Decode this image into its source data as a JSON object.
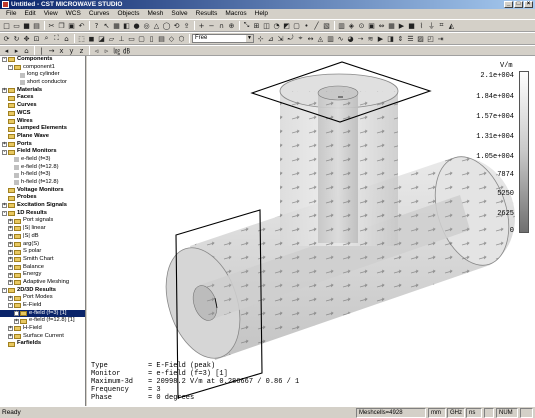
{
  "window": {
    "title": "Untitled - CST MICROWAVE STUDIO"
  },
  "menu": [
    "File",
    "Edit",
    "View",
    "WCS",
    "Curves",
    "Objects",
    "Mesh",
    "Solve",
    "Results",
    "Macros",
    "Help"
  ],
  "toolbar": {
    "mode_select_value": "Free"
  },
  "tree": [
    {
      "label": "Components",
      "level": 0,
      "exp": "-",
      "bold": true,
      "icon": "folder"
    },
    {
      "label": "component1",
      "level": 1,
      "exp": "-",
      "bold": false,
      "icon": "folder"
    },
    {
      "label": "long cylinder",
      "level": 2,
      "exp": "",
      "bold": false,
      "icon": "leaf"
    },
    {
      "label": "short conductor",
      "level": 2,
      "exp": "",
      "bold": false,
      "icon": "leaf"
    },
    {
      "label": "Materials",
      "level": 0,
      "exp": "+",
      "bold": true,
      "icon": "folder"
    },
    {
      "label": "Faces",
      "level": 0,
      "exp": "",
      "bold": true,
      "icon": "folder"
    },
    {
      "label": "Curves",
      "level": 0,
      "exp": "",
      "bold": true,
      "icon": "folder"
    },
    {
      "label": "WCS",
      "level": 0,
      "exp": "",
      "bold": true,
      "icon": "folder"
    },
    {
      "label": "Wires",
      "level": 0,
      "exp": "",
      "bold": true,
      "icon": "folder"
    },
    {
      "label": "Lumped Elements",
      "level": 0,
      "exp": "",
      "bold": true,
      "icon": "folder"
    },
    {
      "label": "Plane Wave",
      "level": 0,
      "exp": "",
      "bold": true,
      "icon": "folder"
    },
    {
      "label": "Ports",
      "level": 0,
      "exp": "+",
      "bold": true,
      "icon": "folder"
    },
    {
      "label": "Field Monitors",
      "level": 0,
      "exp": "-",
      "bold": true,
      "icon": "folder"
    },
    {
      "label": "e-field (f=3)",
      "level": 1,
      "exp": "",
      "bold": false,
      "icon": "leaf"
    },
    {
      "label": "e-field (f=12.8)",
      "level": 1,
      "exp": "",
      "bold": false,
      "icon": "leaf"
    },
    {
      "label": "h-field (f=3)",
      "level": 1,
      "exp": "",
      "bold": false,
      "icon": "leaf"
    },
    {
      "label": "h-field (f=12.8)",
      "level": 1,
      "exp": "",
      "bold": false,
      "icon": "leaf"
    },
    {
      "label": "Voltage Monitors",
      "level": 0,
      "exp": "",
      "bold": true,
      "icon": "folder"
    },
    {
      "label": "Probes",
      "level": 0,
      "exp": "",
      "bold": true,
      "icon": "folder"
    },
    {
      "label": "Excitation Signals",
      "level": 0,
      "exp": "+",
      "bold": true,
      "icon": "folder"
    },
    {
      "label": "1D Results",
      "level": 0,
      "exp": "-",
      "bold": true,
      "icon": "folder"
    },
    {
      "label": "Port signals",
      "level": 1,
      "exp": "+",
      "bold": false,
      "icon": "folder"
    },
    {
      "label": "|S| linear",
      "level": 1,
      "exp": "+",
      "bold": false,
      "icon": "folder"
    },
    {
      "label": "|S| dB",
      "level": 1,
      "exp": "+",
      "bold": false,
      "icon": "folder"
    },
    {
      "label": "arg(S)",
      "level": 1,
      "exp": "+",
      "bold": false,
      "icon": "folder"
    },
    {
      "label": "S polar",
      "level": 1,
      "exp": "+",
      "bold": false,
      "icon": "folder"
    },
    {
      "label": "Smith Chart",
      "level": 1,
      "exp": "+",
      "bold": false,
      "icon": "folder"
    },
    {
      "label": "Balance",
      "level": 1,
      "exp": "+",
      "bold": false,
      "icon": "folder"
    },
    {
      "label": "Energy",
      "level": 1,
      "exp": "+",
      "bold": false,
      "icon": "folder"
    },
    {
      "label": "Adaptive Meshing",
      "level": 1,
      "exp": "+",
      "bold": false,
      "icon": "folder"
    },
    {
      "label": "2D/3D Results",
      "level": 0,
      "exp": "-",
      "bold": true,
      "icon": "folder"
    },
    {
      "label": "Port Modes",
      "level": 1,
      "exp": "+",
      "bold": false,
      "icon": "folder"
    },
    {
      "label": "E-Field",
      "level": 1,
      "exp": "-",
      "bold": false,
      "icon": "folder"
    },
    {
      "label": "e-field (f=3) [1]",
      "level": 2,
      "exp": "+",
      "bold": false,
      "icon": "folder",
      "selected": true
    },
    {
      "label": "e-field (f=12.8) [1]",
      "level": 2,
      "exp": "+",
      "bold": false,
      "icon": "folder"
    },
    {
      "label": "H-Field",
      "level": 1,
      "exp": "+",
      "bold": false,
      "icon": "folder"
    },
    {
      "label": "Surface Current",
      "level": 1,
      "exp": "+",
      "bold": false,
      "icon": "folder"
    },
    {
      "label": "Farfields",
      "level": 0,
      "exp": "",
      "bold": true,
      "icon": "folder"
    }
  ],
  "legend": {
    "unit": "V/m",
    "ticks": [
      "2.1e+004",
      "1.84e+004",
      "1.57e+004",
      "1.31e+004",
      "1.05e+004",
      "7874",
      "5250",
      "2625",
      "0"
    ]
  },
  "info": [
    {
      "key": "Type",
      "value": "= E-Field (peak)"
    },
    {
      "key": "Monitor",
      "value": "= e-field (f=3) [1]"
    },
    {
      "key": "Maximum-3d",
      "value": "= 20998.2 V/m at 0.286667 / 0.86 / 1"
    },
    {
      "key": "Frequency",
      "value": "= 3"
    },
    {
      "key": "Phase",
      "value": "= 0 degrees"
    }
  ],
  "status": {
    "ready": "Ready",
    "meshcells": "Meshcells=4928",
    "units": [
      "mm",
      "GHz",
      "ns"
    ],
    "num": "NUM"
  },
  "colors": {
    "title_start": "#0a246a",
    "title_end": "#a6caf0",
    "chrome": "#d4d0c8",
    "selection": "#0a246a"
  }
}
